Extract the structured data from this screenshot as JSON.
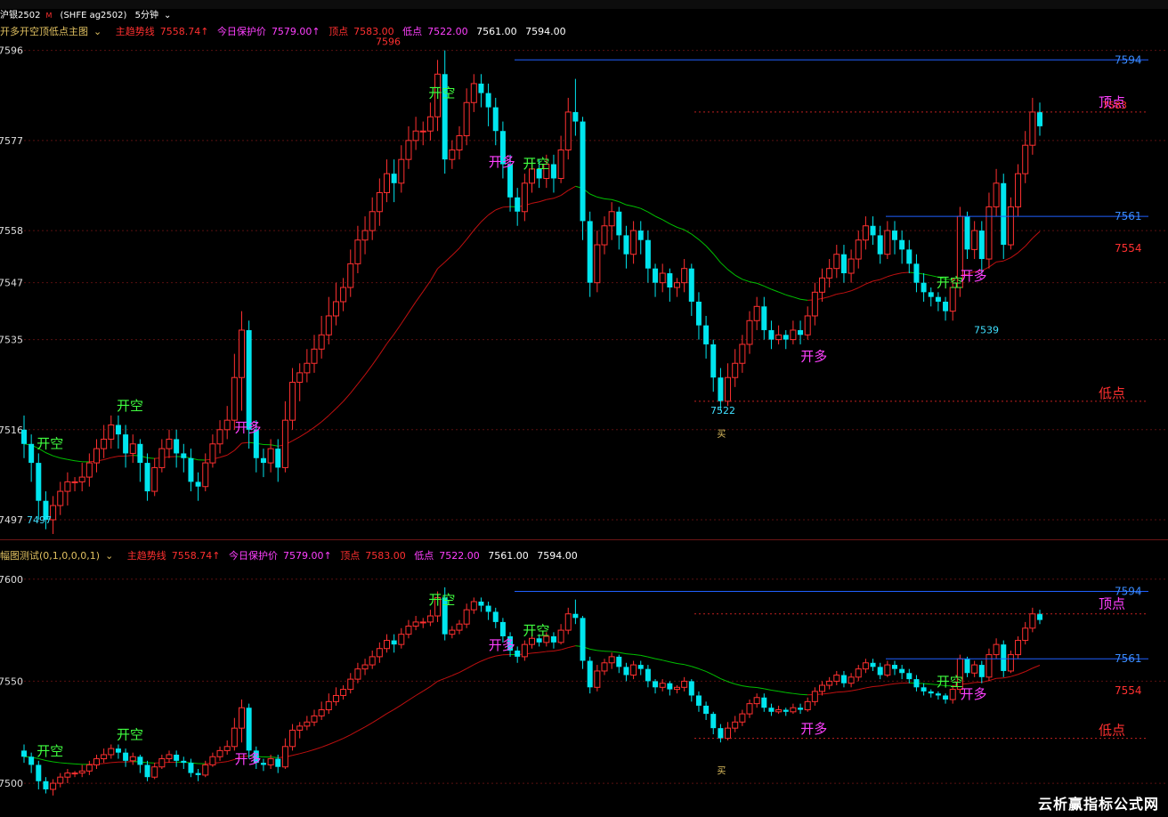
{
  "symbol": {
    "name": "沪银2502",
    "code": "(SHFE ag2502)",
    "period": "5分钟"
  },
  "top_header": {
    "indicator": "开多开空顶低点主图",
    "items": [
      {
        "label": "主趋势线",
        "value": "7558.74↑",
        "color": "#ff3030"
      },
      {
        "label": "今日保护价",
        "value": "7579.00↑",
        "color": "#ff40ff"
      },
      {
        "label": "顶点",
        "value": "7583.00",
        "color": "#ff3030"
      },
      {
        "label": "低点",
        "value": "7522.00",
        "color": "#ff40ff"
      }
    ],
    "extra1": "7561.00",
    "extra2": "7594.00"
  },
  "bottom_header": {
    "indicator": "幅图测试(0,1,0,0,0,1)",
    "items": [
      {
        "label": "主趋势线",
        "value": "7558.74↑",
        "color": "#ff3030"
      },
      {
        "label": "今日保护价",
        "value": "7579.00↑",
        "color": "#ff40ff"
      },
      {
        "label": "顶点",
        "value": "7583.00",
        "color": "#ff3030"
      },
      {
        "label": "低点",
        "value": "7522.00",
        "color": "#ff40ff"
      }
    ],
    "extra1": "7561.00",
    "extra2": "7594.00"
  },
  "top_axis_ticks": [
    "7596",
    "7577",
    "7558",
    "7547",
    "7535",
    "7516",
    "7497"
  ],
  "bottom_axis_ticks": [
    "7600",
    "7550",
    "7500"
  ],
  "signals": {
    "open_short": "开空",
    "open_long": "开多",
    "top": "顶点",
    "low": "低点",
    "buy": "买"
  },
  "levels": {
    "high_line": "7594",
    "mid_line": "7561",
    "trend": "7554",
    "top_price": "7583",
    "top_peak": "7596",
    "low_price": "7522",
    "mid_low": "7539",
    "bottom_left": "7497"
  },
  "watermark": "云析赢指标公式网",
  "colors": {
    "up": "#ff3030",
    "down": "#00e5ee",
    "ma_red": "#c01010",
    "ma_green": "#00c000",
    "blue_line": "#2060ff"
  },
  "chart_data": {
    "type": "candlestick",
    "candles": [
      [
        7516,
        7513,
        7519,
        7510
      ],
      [
        7513,
        7509,
        7515,
        7505
      ],
      [
        7509,
        7501,
        7511,
        7497
      ],
      [
        7501,
        7497,
        7503,
        7495
      ],
      [
        7497,
        7500,
        7502,
        7494
      ],
      [
        7500,
        7503,
        7505,
        7498
      ],
      [
        7503,
        7505,
        7507,
        7500
      ],
      [
        7505,
        7505,
        7506,
        7503
      ],
      [
        7505,
        7506,
        7509,
        7503
      ],
      [
        7506,
        7509,
        7511,
        7504
      ],
      [
        7509,
        7512,
        7514,
        7507
      ],
      [
        7512,
        7514,
        7517,
        7510
      ],
      [
        7514,
        7517,
        7519,
        7512
      ],
      [
        7517,
        7515,
        7519,
        7512
      ],
      [
        7515,
        7511,
        7517,
        7508
      ],
      [
        7511,
        7513,
        7515,
        7509
      ],
      [
        7513,
        7509,
        7514,
        7505
      ],
      [
        7509,
        7503,
        7511,
        7501
      ],
      [
        7503,
        7508,
        7510,
        7502
      ],
      [
        7508,
        7512,
        7514,
        7507
      ],
      [
        7512,
        7514,
        7516,
        7510
      ],
      [
        7514,
        7511,
        7516,
        7508
      ],
      [
        7511,
        7510,
        7513,
        7507
      ],
      [
        7510,
        7505,
        7512,
        7503
      ],
      [
        7505,
        7504,
        7507,
        7501
      ],
      [
        7504,
        7509,
        7511,
        7503
      ],
      [
        7509,
        7513,
        7515,
        7508
      ],
      [
        7513,
        7516,
        7518,
        7511
      ],
      [
        7516,
        7518,
        7521,
        7514
      ],
      [
        7518,
        7527,
        7532,
        7516
      ],
      [
        7527,
        7537,
        7541,
        7520
      ],
      [
        7537,
        7516,
        7539,
        7512
      ],
      [
        7516,
        7510,
        7518,
        7507
      ],
      [
        7510,
        7509,
        7512,
        7506
      ],
      [
        7509,
        7512,
        7514,
        7507
      ],
      [
        7512,
        7508,
        7514,
        7505
      ],
      [
        7508,
        7518,
        7522,
        7507
      ],
      [
        7518,
        7526,
        7529,
        7516
      ],
      [
        7526,
        7528,
        7530,
        7522
      ],
      [
        7528,
        7530,
        7533,
        7526
      ],
      [
        7530,
        7533,
        7536,
        7528
      ],
      [
        7533,
        7536,
        7540,
        7531
      ],
      [
        7536,
        7540,
        7544,
        7534
      ],
      [
        7540,
        7543,
        7547,
        7538
      ],
      [
        7543,
        7546,
        7548,
        7541
      ],
      [
        7546,
        7551,
        7554,
        7544
      ],
      [
        7551,
        7556,
        7559,
        7549
      ],
      [
        7556,
        7558,
        7561,
        7553
      ],
      [
        7558,
        7562,
        7565,
        7556
      ],
      [
        7562,
        7566,
        7569,
        7559
      ],
      [
        7566,
        7570,
        7573,
        7564
      ],
      [
        7570,
        7568,
        7573,
        7564
      ],
      [
        7568,
        7573,
        7576,
        7566
      ],
      [
        7573,
        7577,
        7580,
        7571
      ],
      [
        7577,
        7579,
        7582,
        7575
      ],
      [
        7579,
        7579,
        7581,
        7576
      ],
      [
        7579,
        7582,
        7585,
        7577
      ],
      [
        7582,
        7591,
        7594,
        7579
      ],
      [
        7591,
        7573,
        7596,
        7570
      ],
      [
        7573,
        7575,
        7577,
        7571
      ],
      [
        7575,
        7578,
        7580,
        7573
      ],
      [
        7578,
        7585,
        7588,
        7576
      ],
      [
        7585,
        7589,
        7591,
        7583
      ],
      [
        7589,
        7587,
        7591,
        7584
      ],
      [
        7587,
        7584,
        7589,
        7580
      ],
      [
        7584,
        7579,
        7586,
        7576
      ],
      [
        7579,
        7572,
        7581,
        7569
      ],
      [
        7572,
        7565,
        7574,
        7562
      ],
      [
        7565,
        7562,
        7567,
        7559
      ],
      [
        7562,
        7568,
        7570,
        7560
      ],
      [
        7568,
        7571,
        7573,
        7566
      ],
      [
        7571,
        7569,
        7573,
        7567
      ],
      [
        7569,
        7572,
        7574,
        7567
      ],
      [
        7572,
        7569,
        7574,
        7566
      ],
      [
        7569,
        7575,
        7578,
        7568
      ],
      [
        7575,
        7583,
        7586,
        7573
      ],
      [
        7583,
        7581,
        7590,
        7578
      ],
      [
        7581,
        7560,
        7582,
        7556
      ],
      [
        7560,
        7547,
        7562,
        7544
      ],
      [
        7547,
        7555,
        7558,
        7545
      ],
      [
        7555,
        7559,
        7561,
        7553
      ],
      [
        7559,
        7562,
        7564,
        7556
      ],
      [
        7562,
        7557,
        7563,
        7554
      ],
      [
        7557,
        7553,
        7559,
        7550
      ],
      [
        7553,
        7558,
        7560,
        7551
      ],
      [
        7558,
        7556,
        7560,
        7553
      ],
      [
        7556,
        7550,
        7558,
        7547
      ],
      [
        7550,
        7547,
        7551,
        7544
      ],
      [
        7547,
        7549,
        7551,
        7545
      ],
      [
        7549,
        7546,
        7550,
        7543
      ],
      [
        7546,
        7547,
        7548,
        7544
      ],
      [
        7547,
        7550,
        7552,
        7545
      ],
      [
        7550,
        7543,
        7551,
        7540
      ],
      [
        7543,
        7538,
        7545,
        7535
      ],
      [
        7538,
        7534,
        7540,
        7531
      ],
      [
        7534,
        7527,
        7535,
        7524
      ],
      [
        7527,
        7522,
        7529,
        7520
      ],
      [
        7522,
        7527,
        7530,
        7521
      ],
      [
        7527,
        7530,
        7533,
        7525
      ],
      [
        7530,
        7534,
        7536,
        7528
      ],
      [
        7534,
        7539,
        7541,
        7532
      ],
      [
        7539,
        7542,
        7544,
        7537
      ],
      [
        7542,
        7537,
        7544,
        7535
      ],
      [
        7537,
        7535,
        7539,
        7533
      ],
      [
        7535,
        7536,
        7538,
        7534
      ],
      [
        7536,
        7535,
        7537,
        7533
      ],
      [
        7535,
        7537,
        7539,
        7534
      ],
      [
        7537,
        7536,
        7539,
        7534
      ],
      [
        7536,
        7540,
        7542,
        7535
      ],
      [
        7540,
        7545,
        7547,
        7538
      ],
      [
        7545,
        7548,
        7550,
        7543
      ],
      [
        7548,
        7550,
        7552,
        7546
      ],
      [
        7550,
        7553,
        7555,
        7548
      ],
      [
        7553,
        7549,
        7555,
        7547
      ],
      [
        7549,
        7552,
        7554,
        7547
      ],
      [
        7552,
        7556,
        7558,
        7550
      ],
      [
        7556,
        7559,
        7561,
        7554
      ],
      [
        7559,
        7557,
        7561,
        7555
      ],
      [
        7557,
        7553,
        7559,
        7551
      ],
      [
        7553,
        7558,
        7560,
        7552
      ],
      [
        7558,
        7556,
        7560,
        7553
      ],
      [
        7556,
        7554,
        7558,
        7551
      ],
      [
        7554,
        7551,
        7556,
        7549
      ],
      [
        7551,
        7547,
        7553,
        7545
      ],
      [
        7547,
        7545,
        7549,
        7543
      ],
      [
        7545,
        7544,
        7546,
        7542
      ],
      [
        7544,
        7543,
        7545,
        7541
      ],
      [
        7543,
        7541,
        7544,
        7539
      ],
      [
        7541,
        7546,
        7548,
        7539
      ],
      [
        7546,
        7561,
        7563,
        7544
      ],
      [
        7561,
        7554,
        7562,
        7552
      ],
      [
        7554,
        7558,
        7560,
        7552
      ],
      [
        7558,
        7552,
        7560,
        7549
      ],
      [
        7552,
        7563,
        7566,
        7550
      ],
      [
        7563,
        7568,
        7571,
        7561
      ],
      [
        7568,
        7555,
        7570,
        7552
      ],
      [
        7555,
        7563,
        7565,
        7554
      ],
      [
        7563,
        7570,
        7572,
        7561
      ],
      [
        7570,
        7576,
        7579,
        7568
      ],
      [
        7576,
        7583,
        7586,
        7574
      ],
      [
        7583,
        7580,
        7585,
        7578
      ]
    ],
    "ylim_top": [
      7494,
      7598
    ],
    "ylim_bottom": [
      7490,
      7606
    ],
    "grid": true
  }
}
